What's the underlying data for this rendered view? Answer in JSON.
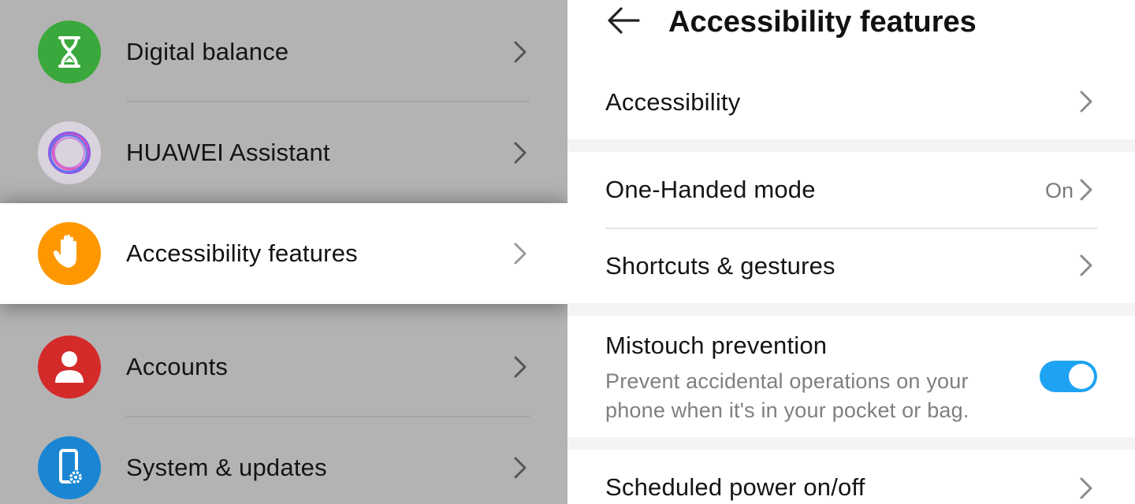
{
  "left_list": {
    "items": [
      {
        "label": "Digital balance",
        "icon": "hourglass-icon",
        "color": "#39a93b"
      },
      {
        "label": "HUAWEI Assistant",
        "icon": "assistant-ring-icon",
        "color": "#d8d3dc"
      },
      {
        "label": "Accessibility features",
        "icon": "hand-icon",
        "color": "#ff9800",
        "selected": true
      },
      {
        "label": "Accounts",
        "icon": "person-icon",
        "color": "#d62a2a"
      },
      {
        "label": "System & updates",
        "icon": "phone-gear-icon",
        "color": "#1b86d4"
      }
    ]
  },
  "header": {
    "title": "Accessibility features",
    "back_icon": "back-arrow-icon"
  },
  "settings": {
    "accessibility": {
      "label": "Accessibility"
    },
    "one_handed": {
      "label": "One-Handed mode",
      "status": "On"
    },
    "shortcuts": {
      "label": "Shortcuts & gestures"
    },
    "mistouch": {
      "label": "Mistouch prevention",
      "description_line1": "Prevent accidental operations on your",
      "description_line2": "phone when it's in your pocket or bag.",
      "enabled": true
    },
    "scheduled_power": {
      "label": "Scheduled power on/off"
    }
  },
  "colors": {
    "accent": "#1ea3f3",
    "dim_background": "#b3b3b3"
  }
}
